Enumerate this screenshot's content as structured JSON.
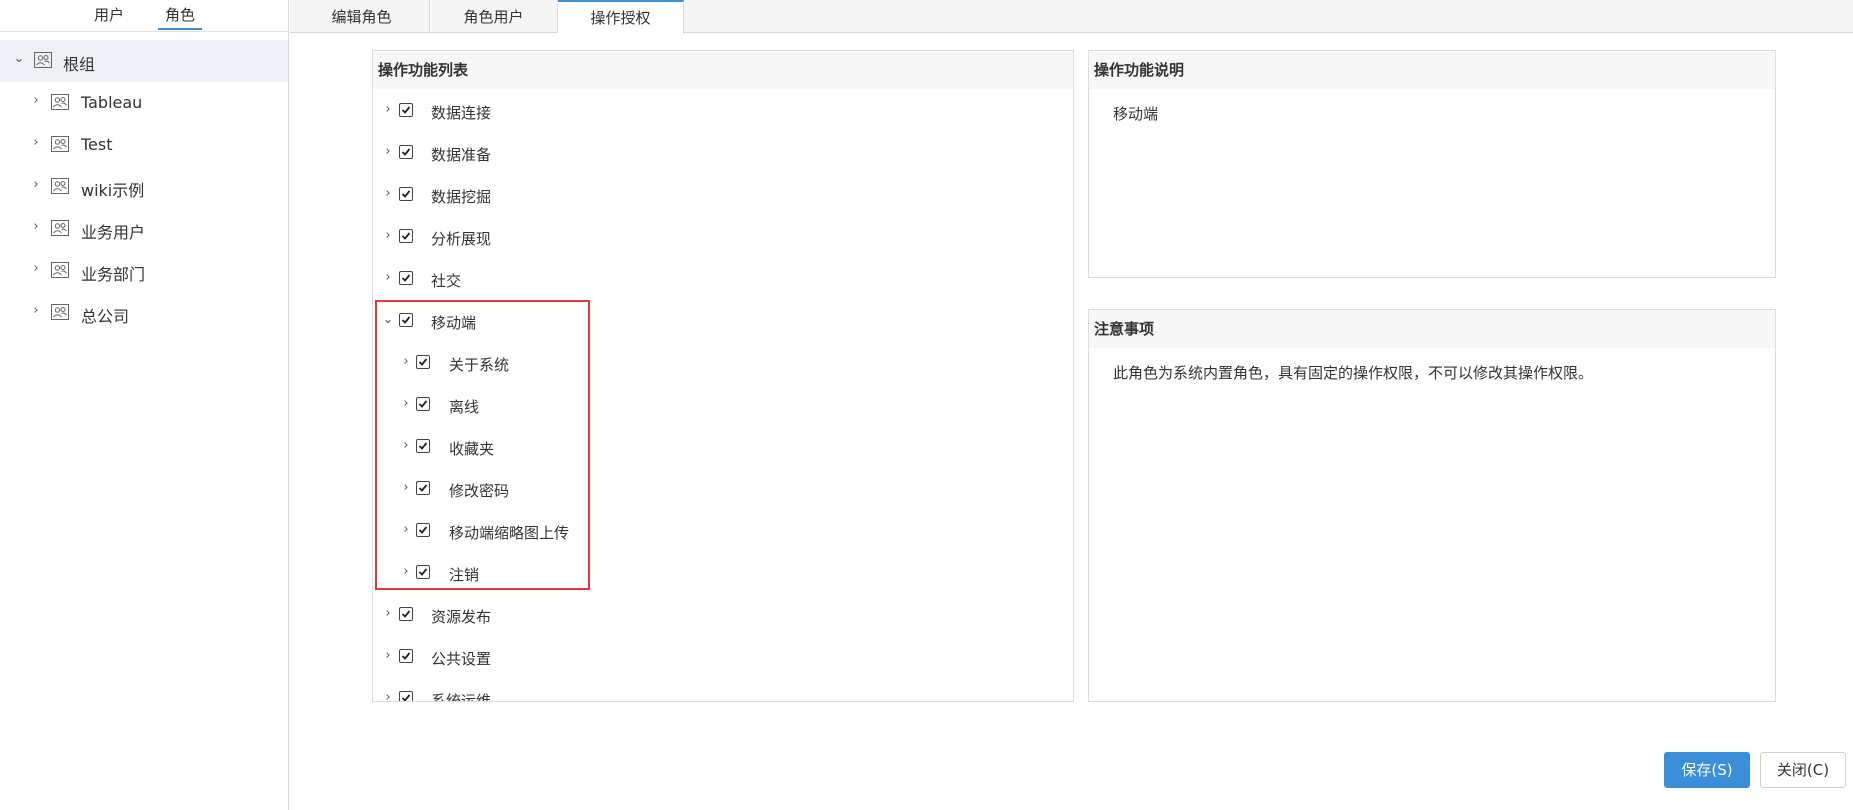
{
  "left_tabs": {
    "users": "用户",
    "roles": "角色"
  },
  "tree": [
    {
      "label": "根组",
      "expanded": true
    },
    {
      "label": "Tableau"
    },
    {
      "label": "Test"
    },
    {
      "label": "wiki示例"
    },
    {
      "label": "业务用户"
    },
    {
      "label": "业务部门"
    },
    {
      "label": "总公司"
    }
  ],
  "top_tabs": [
    "编辑角色",
    "角色用户",
    "操作授权"
  ],
  "active_top_tab": "操作授权",
  "operations_panel": {
    "title": "操作功能列表",
    "items": [
      {
        "label": "数据连接",
        "checked": true
      },
      {
        "label": "数据准备",
        "checked": true
      },
      {
        "label": "数据挖掘",
        "checked": true
      },
      {
        "label": "分析展现",
        "checked": true
      },
      {
        "label": "社交",
        "checked": true
      },
      {
        "label": "移动端",
        "checked": true,
        "expanded": true
      },
      {
        "label": "关于系统",
        "checked": true
      },
      {
        "label": "离线",
        "checked": true
      },
      {
        "label": "收藏夹",
        "checked": true
      },
      {
        "label": "修改密码",
        "checked": true
      },
      {
        "label": "移动端缩略图上传",
        "checked": true
      },
      {
        "label": "注销",
        "checked": true
      },
      {
        "label": "资源发布",
        "checked": true
      },
      {
        "label": "公共设置",
        "checked": true
      },
      {
        "label": "系统运维",
        "checked": true
      }
    ]
  },
  "description_panel": {
    "title": "操作功能说明",
    "text": "移动端"
  },
  "notes_panel": {
    "title": "注意事项",
    "text": "此角色为系统内置角色，具有固定的操作权限，不可以修改其操作权限。"
  },
  "buttons": {
    "save": "保存(S)",
    "close": "关闭(C)"
  },
  "colors": {
    "accent": "#3b8fd8",
    "highlight": "#e53935"
  }
}
